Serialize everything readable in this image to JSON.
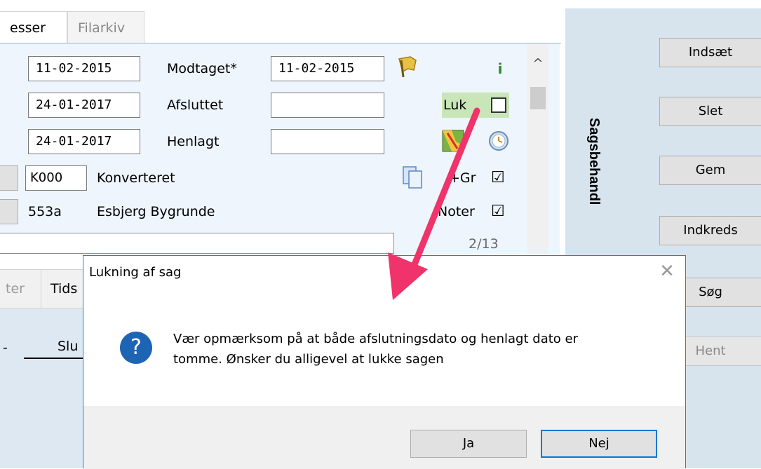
{
  "tabs": [
    {
      "label": "esser"
    },
    {
      "label": "Filarkiv"
    }
  ],
  "form": {
    "date1": "11-02-2015",
    "modtaget_label": "Modtaget*",
    "modtaget_value": "11-02-2015",
    "info_glyph": "i",
    "date2": "24-01-2017",
    "afsluttet_label": "Afsluttet",
    "afsluttet_value": "",
    "luk_label": "Luk",
    "date3": "24-01-2017",
    "henlagt_label": "Henlagt",
    "henlagt_value": "",
    "code1": "K000",
    "code1_label": "Konverteret",
    "gr_label": "+Gr",
    "gr_checked": "☑",
    "code2": "553a",
    "code2_label": "Esbjerg Bygrunde",
    "noter_label": "Noter",
    "noter_checked": "☑",
    "pager": "2/13",
    "scroll_up_glyph": "^"
  },
  "lower": {
    "tab1_fragment": "ter",
    "tab2_fragment": "Tids",
    "column_fragment": "Slu",
    "dash": "-"
  },
  "sidebar": {
    "title": "Sagsbehandl",
    "buttons": [
      {
        "label": "Indsæt"
      },
      {
        "label": "Slet"
      },
      {
        "label": "Gem"
      },
      {
        "label": "Indkreds"
      },
      {
        "label": "Søg"
      },
      {
        "label": "Hent"
      }
    ]
  },
  "dialog": {
    "title": "Lukning af sag",
    "close_glyph": "✕",
    "icon_glyph": "?",
    "message_line1": "Vær opmærksom på at både afslutningsdato og henlagt dato er",
    "message_line2": "tomme. Ønsker du alligevel at lukke sagen",
    "yes": "Ja",
    "no": "Nej"
  },
  "colors": {
    "dialog_border": "#1883d7",
    "default_button_border": "#0078d7",
    "arrow": "#f0336a",
    "luk_highlight": "#c8e6b8",
    "question_icon": "#1e64b4"
  }
}
